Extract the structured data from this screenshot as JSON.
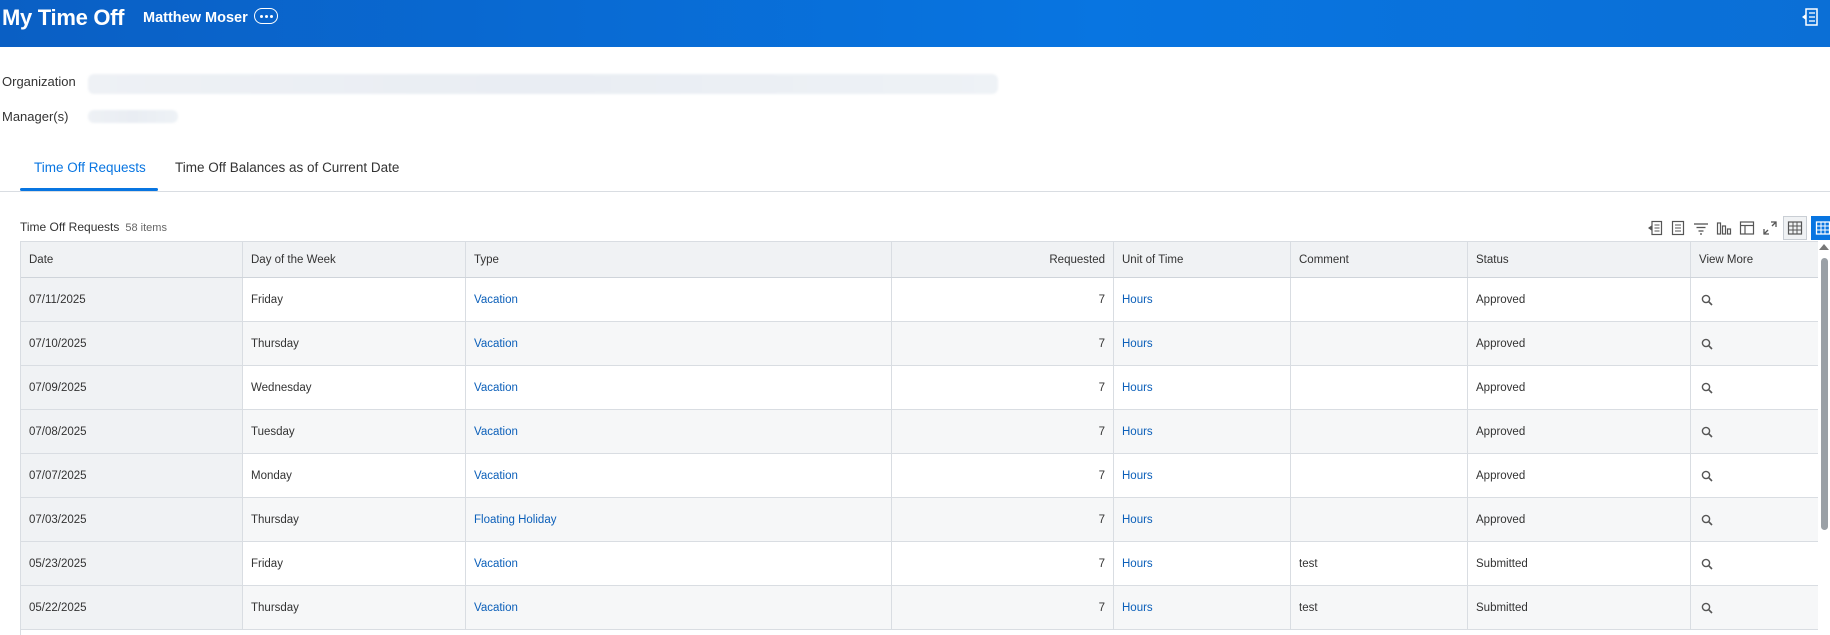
{
  "header": {
    "title": "My Time Off",
    "worker_name": "Matthew Moser"
  },
  "info": {
    "organization_label": "Organization",
    "managers_label": "Manager(s)"
  },
  "tabs": [
    {
      "label": "Time Off Requests",
      "active": true
    },
    {
      "label": "Time Off Balances as of Current Date",
      "active": false
    }
  ],
  "grid": {
    "title": "Time Off Requests",
    "count": "58 items",
    "columns": [
      "Date",
      "Day of the Week",
      "Type",
      "Requested",
      "Unit of Time",
      "Comment",
      "Status",
      "View More"
    ],
    "rows": [
      {
        "date": "07/11/2025",
        "day": "Friday",
        "type": "Vacation",
        "requested": "7",
        "unit": "Hours",
        "comment": "",
        "status": "Approved"
      },
      {
        "date": "07/10/2025",
        "day": "Thursday",
        "type": "Vacation",
        "requested": "7",
        "unit": "Hours",
        "comment": "",
        "status": "Approved"
      },
      {
        "date": "07/09/2025",
        "day": "Wednesday",
        "type": "Vacation",
        "requested": "7",
        "unit": "Hours",
        "comment": "",
        "status": "Approved"
      },
      {
        "date": "07/08/2025",
        "day": "Tuesday",
        "type": "Vacation",
        "requested": "7",
        "unit": "Hours",
        "comment": "",
        "status": "Approved"
      },
      {
        "date": "07/07/2025",
        "day": "Monday",
        "type": "Vacation",
        "requested": "7",
        "unit": "Hours",
        "comment": "",
        "status": "Approved"
      },
      {
        "date": "07/03/2025",
        "day": "Thursday",
        "type": "Floating Holiday",
        "requested": "7",
        "unit": "Hours",
        "comment": "",
        "status": "Approved"
      },
      {
        "date": "05/23/2025",
        "day": "Friday",
        "type": "Vacation",
        "requested": "7",
        "unit": "Hours",
        "comment": "test",
        "status": "Submitted"
      },
      {
        "date": "05/22/2025",
        "day": "Thursday",
        "type": "Vacation",
        "requested": "7",
        "unit": "Hours",
        "comment": "test",
        "status": "Submitted"
      }
    ]
  },
  "icons": {
    "related_actions": "more-horizontal-icon",
    "header_export": "export-icon",
    "view_more": "magnifier-icon"
  },
  "colors": {
    "header_blue": "#0875e1",
    "link_blue": "#0b5fb9",
    "header_row_bg": "#f0f2f4"
  }
}
